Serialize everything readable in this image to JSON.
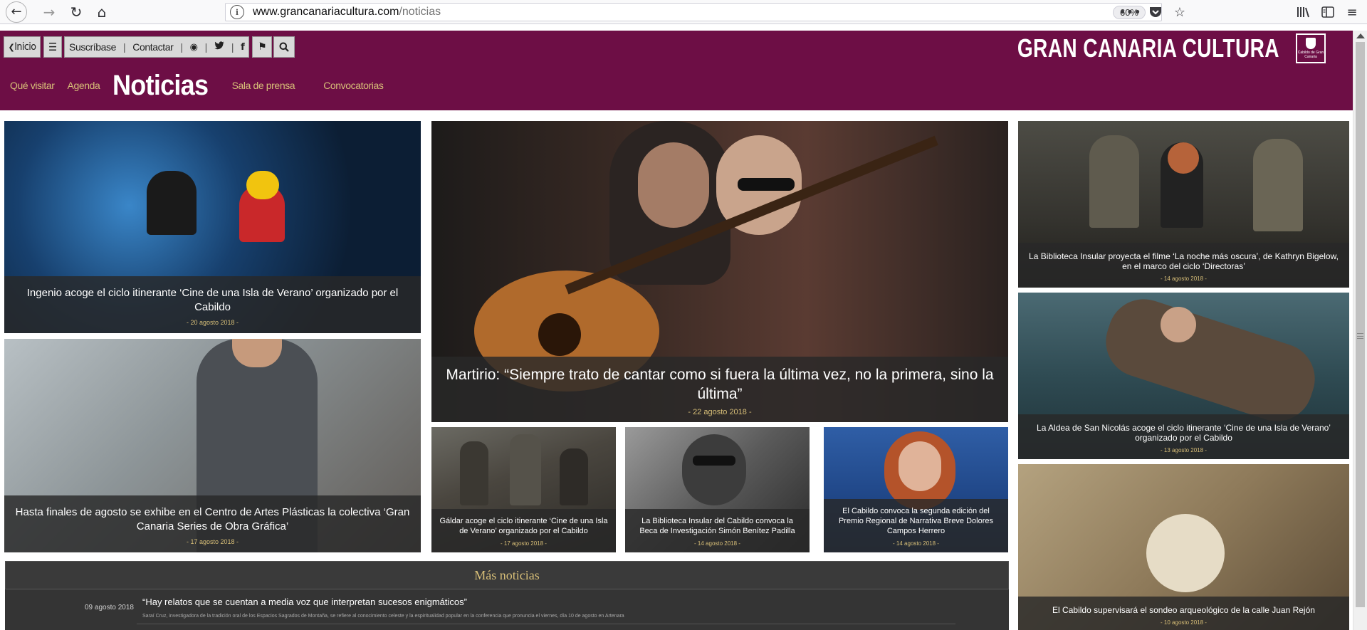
{
  "browser": {
    "url_host": "www.grancanariacultura.com",
    "url_path": "/noticias",
    "zoom": "60%",
    "icons": [
      "back-arrow-icon",
      "forward-arrow-icon",
      "reload-icon",
      "home-icon",
      "site-info-icon",
      "more-actions-icon",
      "pocket-icon",
      "bookmark-star-icon",
      "library-icon",
      "sidebar-icon",
      "hamburger-menu-icon"
    ]
  },
  "header": {
    "inicio": "Inicio",
    "menu_glyph": "☰",
    "suscribase": "Suscríbase",
    "contactar": "Contactar",
    "sep": "|",
    "rss_glyph": "◉",
    "twitter_glyph": "🐦",
    "facebook_glyph": "f",
    "flag_glyph": "⚑",
    "search_glyph": "⚲",
    "brand": "GRAN CANARIA CULTURA",
    "logo_text": "Cabildo de Gran Canaria",
    "accent_color": "#6d0e45",
    "gold_color": "#d8bf78"
  },
  "subnav": {
    "items": [
      "Qué visitar",
      "Agenda",
      "Noticias",
      "Sala de prensa",
      "Convocatorias"
    ],
    "active": "Noticias"
  },
  "tiles": {
    "lego": {
      "title": "Ingenio acoge el ciclo itinerante ‘Cine de una Isla de Verano’ organizado por el Cabildo",
      "date": "- 20 agosto 2018 -"
    },
    "centro": {
      "title": "Hasta finales de agosto se exhibe en el Centro de Artes Plásticas la colectiva ‘Gran Canaria Series de Obra Gráfica’",
      "date": "- 17 agosto 2018 -"
    },
    "martirio": {
      "title": "Martirio: “Siempre trato de cantar como si fuera la última vez, no la primera, sino la última”",
      "date": "- 22 agosto 2018 -"
    },
    "galdar": {
      "title": "Gáldar acoge el ciclo itinerante ‘Cine de una Isla de Verano’ organizado por el Cabildo",
      "date": "- 17 agosto 2018 -"
    },
    "beca": {
      "title": "La Biblioteca Insular del Cabildo convoca la Beca de Investigación Simón Benítez Padilla",
      "date": "- 14 agosto 2018 -"
    },
    "premio": {
      "title": "El Cabildo convoca la segunda edición del Premio Regional de Narrativa Breve Dolores Campos Herrero",
      "date": "- 14 agosto 2018 -"
    },
    "noche": {
      "title": "La Biblioteca Insular proyecta el filme ‘La noche más oscura’, de Kathryn Bigelow, en el marco del ciclo ‘Directoras’",
      "date": "- 14 agosto 2018 -"
    },
    "aldea": {
      "title": "La Aldea de San Nicolás acoge el ciclo itinerante ‘Cine de una Isla de Verano’ organizado por el Cabildo",
      "date": "- 13 agosto 2018 -"
    },
    "rejon": {
      "title": "El Cabildo supervisará el sondeo arqueológico de la calle Juan Rejón",
      "date": "- 10 agosto 2018 -"
    }
  },
  "more_news": {
    "heading": "Más noticias",
    "items": [
      {
        "date": "09 agosto 2018",
        "title": "“Hay relatos que se cuentan a media voz que interpretan sucesos enigmáticos”",
        "excerpt": "Saraí Cruz, investigadora de la tradición oral de los Espacios Sagrados de Montaña, se refiere al conocimiento celeste y la espiritualidad popular en la conferencia que pronuncia el viernes, día 10 de agosto en Artenara"
      }
    ]
  }
}
